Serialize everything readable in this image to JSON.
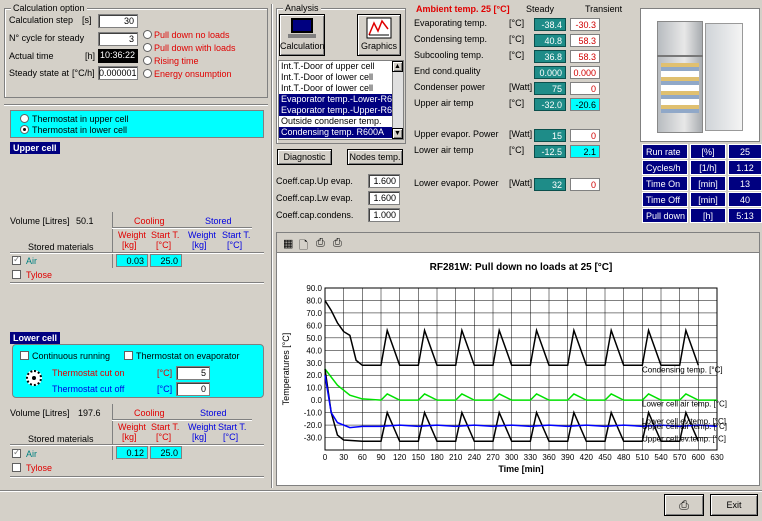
{
  "calc": {
    "legend": "Calculation option",
    "step_label": "Calculation step",
    "step_unit": "[s]",
    "step_value": "30",
    "ncycle_label": "N° cycle for steady",
    "ncycle_value": "3",
    "time_label": "Actual time",
    "time_unit": "[h]",
    "time_value": "10:36:22",
    "steady_label": "Steady state at",
    "steady_unit": "[°C/h]",
    "steady_value": "0.000001",
    "modes": [
      "Pull down no loads",
      "Pull down with loads",
      "Rising time",
      "Energy onsumption"
    ]
  },
  "thermostat": {
    "options": [
      "Thermostat in upper cell",
      "Thermostat in lower cell"
    ]
  },
  "upper_cell": {
    "title": "Upper cell",
    "volume_label": "Volume [Litres]",
    "volume_value": "50.1",
    "cooling": "Cooling",
    "stored": "Stored",
    "weight": "Weight",
    "weight_unit": "[kg]",
    "start": "Start T.",
    "start_unit": "[°C]",
    "materials": "Stored materials",
    "air": "Air",
    "tylose": "Tylose",
    "air_weight": "0.03",
    "air_start": "25.0"
  },
  "lower_cell": {
    "title": "Lower cell",
    "continuous": "Continuous running",
    "thermo_evap": "Thermostat on evaporator",
    "cut_on": "Thermostat cut on",
    "cut_off": "Thermostat cut off",
    "unit": "[°C]",
    "cut_on_value": "5",
    "cut_off_value": "0",
    "volume_label": "Volume [Litres]",
    "volume_value": "197.6",
    "cooling": "Cooling",
    "stored": "Stored",
    "weight": "Weight",
    "weight_unit": "[kg]",
    "start": "Start T.",
    "start_unit": "[°C]",
    "materials": "Stored materials",
    "air": "Air",
    "tylose": "Tylose",
    "air_weight": "0.12",
    "air_start": "25.0"
  },
  "analysis": {
    "legend": "Analysis",
    "calc_btn": "Calculation",
    "graph_btn": "Graphics",
    "list": [
      {
        "text": "Int.T.-Door of upper cell",
        "sel": false
      },
      {
        "text": "Int.T.-Door of lower cell",
        "sel": false
      },
      {
        "text": "Int.T.-Door of lower cell",
        "sel": false
      },
      {
        "text": "Evaporator temp.-Lower-R60",
        "sel": true
      },
      {
        "text": "Evaporator temp.-Upper-R60",
        "sel": true
      },
      {
        "text": "Outside condenser temp.",
        "sel": false
      },
      {
        "text": "Condensing temp. R600A",
        "sel": true
      }
    ],
    "diag_btn": "Diagnostic",
    "nodes_btn": "Nodes temp.",
    "coeff_up": "Coeff.cap.Up evap.",
    "coeff_lw": "Coeff.cap.Lw evap.",
    "coeff_cond": "Coeff.cap.condens.",
    "coeff_up_v": "1.600",
    "coeff_lw_v": "1.600",
    "coeff_cond_v": "1.000"
  },
  "results": {
    "ambient": "Ambient temp. 25 [°C]",
    "steady": "Steady",
    "transient": "Transient",
    "rows": [
      {
        "label": "Evaporating temp.",
        "unit": "[°C]",
        "steady": "-38.4",
        "transient": "-30.3"
      },
      {
        "label": "Condensing temp.",
        "unit": "[°C]",
        "steady": "40.8",
        "transient": "58.3"
      },
      {
        "label": "Subcooling temp.",
        "unit": "[°C]",
        "steady": "36.8",
        "transient": "58.3"
      },
      {
        "label": "End cond.quality",
        "unit": "",
        "steady": "0.000",
        "transient": "0.000"
      },
      {
        "label": "Condenser power",
        "unit": "[Watt]",
        "steady": "75",
        "transient": "0"
      },
      {
        "label": "Upper air temp",
        "unit": "[°C]",
        "steady": "-32.0",
        "transient": "-20.6"
      },
      {
        "label": "Upper evapor. Power",
        "unit": "[Watt]",
        "steady": "15",
        "transient": "0"
      },
      {
        "label": "Lower air temp",
        "unit": "[°C]",
        "steady": "-12.5",
        "transient": "2.1"
      },
      {
        "label": "Lower evapor. Power",
        "unit": "[Watt]",
        "steady": "32",
        "transient": "0"
      }
    ]
  },
  "summary": [
    {
      "label": "Run rate",
      "unit": "[%]",
      "value": "25"
    },
    {
      "label": "Cycles/h",
      "unit": "[1/h]",
      "value": "1.12"
    },
    {
      "label": "Time On",
      "unit": "[min]",
      "value": "13"
    },
    {
      "label": "Time Off",
      "unit": "[min]",
      "value": "40"
    },
    {
      "label": "Pull down",
      "unit": "[h]",
      "value": "5:13"
    }
  ],
  "chart_data": {
    "type": "line",
    "title": "RF281W: Pull down no loads at 25 [°C]",
    "xlabel": "Time [min]",
    "ylabel": "Temperatures [°C]",
    "xlim": [
      0,
      630
    ],
    "ylim": [
      -40,
      90
    ],
    "xticks": [
      0,
      30,
      60,
      90,
      120,
      150,
      180,
      210,
      240,
      270,
      300,
      330,
      360,
      390,
      420,
      450,
      480,
      510,
      540,
      570,
      600,
      630
    ],
    "yticks": [
      90,
      80,
      70,
      60,
      50,
      40,
      30,
      20,
      10,
      0,
      -10,
      -20,
      -30
    ],
    "grid": true,
    "series": [
      {
        "name": "Condensing temp. [°C]",
        "color": "#000000",
        "x": [
          0,
          10,
          20,
          30,
          40,
          50,
          60,
          90,
          100,
          120,
          150,
          160,
          180,
          210,
          220,
          240,
          270,
          280,
          300,
          330,
          340,
          360,
          390,
          400,
          420,
          450,
          460,
          480,
          510,
          520,
          540,
          570,
          580,
          600
        ],
        "y": [
          80,
          72,
          62,
          55,
          52,
          32,
          28,
          28,
          56,
          28,
          28,
          56,
          28,
          28,
          56,
          28,
          28,
          56,
          28,
          28,
          56,
          28,
          28,
          56,
          28,
          28,
          56,
          28,
          28,
          56,
          28,
          28,
          56,
          28
        ]
      },
      {
        "name": "Lower cell air temp. [°C]",
        "color": "#00e000",
        "x": [
          0,
          20,
          40,
          60,
          90,
          100,
          120,
          150,
          160,
          180,
          210,
          220,
          240,
          270,
          280,
          300,
          330,
          340,
          360,
          390,
          400,
          420,
          450,
          460,
          480,
          510,
          520,
          540,
          570,
          580,
          600,
          630
        ],
        "y": [
          25,
          12,
          4,
          1,
          0,
          5,
          0,
          0,
          5,
          0,
          0,
          5,
          0,
          0,
          5,
          0,
          0,
          5,
          0,
          0,
          5,
          0,
          0,
          5,
          0,
          0,
          5,
          0,
          0,
          5,
          0,
          0
        ]
      },
      {
        "name": "Lower cell ev.temp. [°C]",
        "color": "#000000",
        "x": [
          0,
          10,
          20,
          30,
          60,
          90,
          100,
          120,
          150,
          160,
          180,
          210,
          220,
          240,
          270,
          280,
          300,
          330,
          340,
          360,
          390,
          400,
          420,
          450,
          460,
          480,
          510,
          520,
          540,
          570,
          580,
          600
        ],
        "y": [
          25,
          -10,
          -28,
          -32,
          -33,
          -33,
          -10,
          -33,
          -33,
          -10,
          -33,
          -33,
          -10,
          -33,
          -33,
          -10,
          -33,
          -33,
          -10,
          -33,
          -33,
          -10,
          -33,
          -33,
          -10,
          -33,
          -33,
          -10,
          -33,
          -33,
          -10,
          -33
        ]
      },
      {
        "name": "Upper cell air temp. [°C]",
        "color": "#0000ff",
        "x": [
          0,
          10,
          20,
          40,
          60,
          90,
          120,
          150,
          180,
          210,
          240,
          270,
          300,
          330,
          360,
          390,
          420,
          450,
          480,
          510,
          540,
          570,
          600,
          630
        ],
        "y": [
          20,
          -10,
          -18,
          -22,
          -21,
          -21,
          -20,
          -21,
          -20,
          -21,
          -20,
          -21,
          -20,
          -21,
          -20,
          -21,
          -20,
          -21,
          -20,
          -21,
          -20,
          -21,
          -20,
          -21
        ]
      },
      {
        "name": "Upper cell ev.temp. [°C]",
        "color": "#000000",
        "x": [],
        "y": []
      }
    ]
  },
  "footer": {
    "exit": "Exit"
  }
}
